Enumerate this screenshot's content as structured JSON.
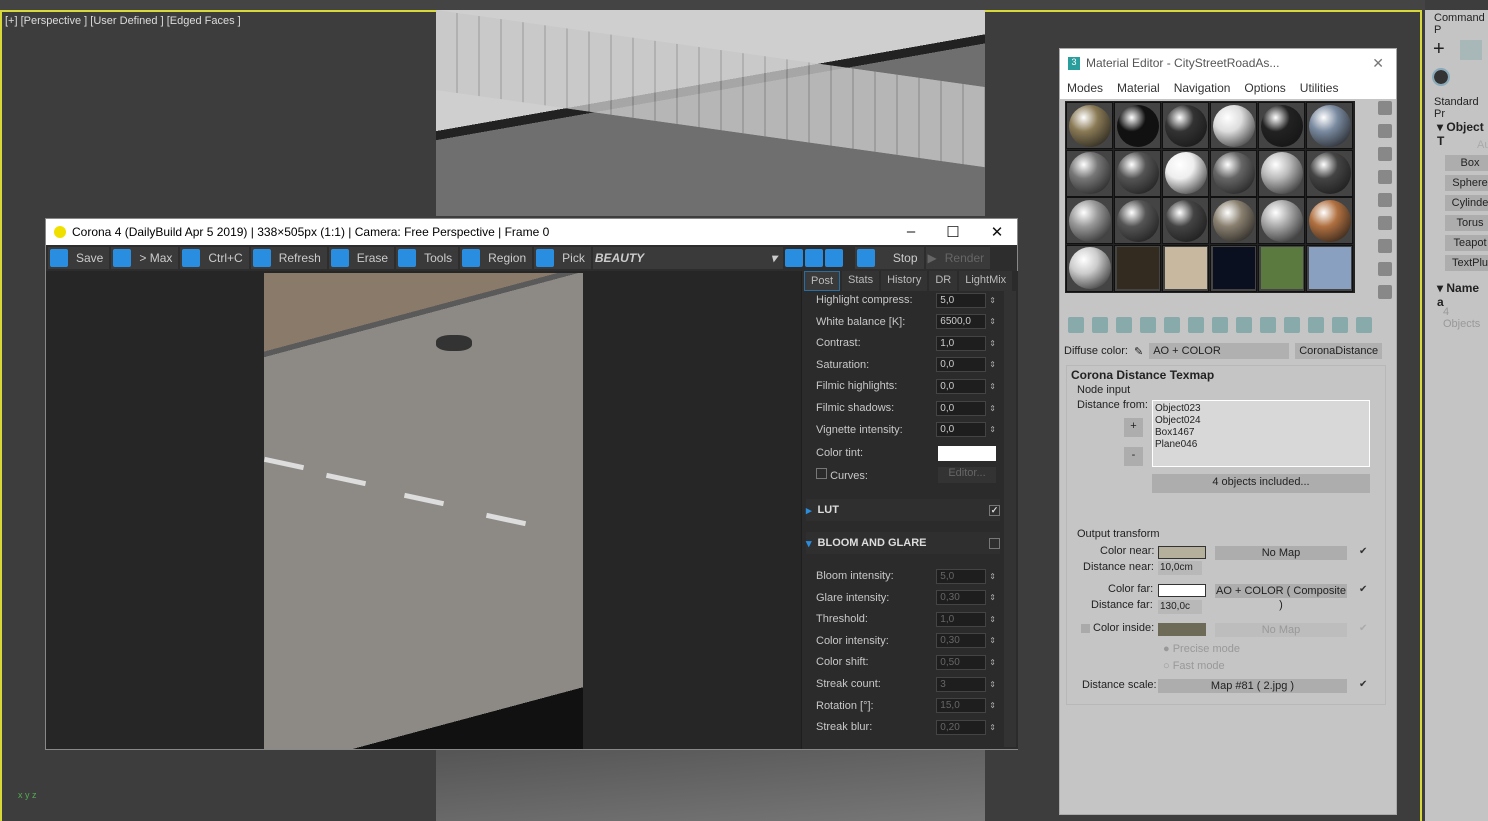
{
  "viewport": {
    "label": "[+] [Perspective ] [User Defined ] [Edged Faces ]",
    "axis": "x y z"
  },
  "vfb": {
    "title": "Corona 4 (DailyBuild Apr  5 2019) | 338×505px (1:1) | Camera: Free Perspective | Frame 0",
    "toolbar": [
      "Save",
      "> Max",
      "Ctrl+C",
      "Refresh",
      "Erase",
      "Tools",
      "Region",
      "Pick"
    ],
    "channel": "BEAUTY",
    "stop": "Stop",
    "render": "Render",
    "tabs": [
      "Post",
      "Stats",
      "History",
      "DR",
      "LightMix"
    ],
    "active_tab": "Post",
    "post": [
      {
        "label": "Highlight compress:",
        "value": "5,0"
      },
      {
        "label": "White balance [K]:",
        "value": "6500,0"
      },
      {
        "label": "Contrast:",
        "value": "1,0"
      },
      {
        "label": "Saturation:",
        "value": "0,0"
      },
      {
        "label": "Filmic highlights:",
        "value": "0,0"
      },
      {
        "label": "Filmic shadows:",
        "value": "0,0"
      },
      {
        "label": "Vignette intensity:",
        "value": "0,0"
      }
    ],
    "color_tint": "Color tint:",
    "color_tint_value": "#ffffff",
    "curves": "Curves:",
    "editor": "Editor...",
    "lut": "LUT",
    "lut_checked": true,
    "bloom": "BLOOM AND GLARE",
    "bloom_checked": false,
    "bloom_rows": [
      {
        "label": "Bloom intensity:",
        "value": "5,0"
      },
      {
        "label": "Glare intensity:",
        "value": "0,30"
      },
      {
        "label": "Threshold:",
        "value": "1,0"
      },
      {
        "label": "Color intensity:",
        "value": "0,30"
      },
      {
        "label": "Color shift:",
        "value": "0,50"
      },
      {
        "label": "Streak count:",
        "value": "3"
      },
      {
        "label": "Rotation [°]:",
        "value": "15,0"
      },
      {
        "label": "Streak blur:",
        "value": "0,20"
      }
    ]
  },
  "material_editor": {
    "title": "Material Editor - CityStreetRoadAs...",
    "menu": [
      "Modes",
      "Material",
      "Navigation",
      "Options",
      "Utilities"
    ],
    "diffuse_label": "Diffuse color:",
    "diffuse_value": "AO + COLOR",
    "map_name": "CoronaDistance",
    "rollout_title": "Corona Distance Texmap",
    "node_input": "Node input",
    "distance_from": "Distance from:",
    "objects": [
      "Object023",
      "Object024",
      "Box1467",
      "Plane046"
    ],
    "plus": "+",
    "minus": "-",
    "included": "4 objects included...",
    "output_transform": "Output transform",
    "color_near": "Color near:",
    "color_near_value": "#b5b09c",
    "near_map": "No Map",
    "distance_near": "Distance near:",
    "distance_near_value": "10,0cm",
    "color_far": "Color far:",
    "color_far_value": "#ffffff",
    "far_map": "AO + COLOR  ( Composite )",
    "distance_far": "Distance far:",
    "distance_far_value": "130,0c",
    "color_inside": "Color inside:",
    "color_inside_value": "#6e6a58",
    "inside_map": "No Map",
    "precise": "Precise mode",
    "fast": "Fast mode",
    "distance_scale": "Distance scale:",
    "scale_map": "Map #81 ( 2.jpg )"
  },
  "command_panel": {
    "title": "Command P",
    "dropdown": "Standard Pr",
    "section": "Object T",
    "auto": "Au",
    "buttons": [
      "Box",
      "Sphere",
      "Cylinde",
      "Torus",
      "Teapot",
      "TextPlu"
    ],
    "name_section": "Name a",
    "name_value": "4 Objects"
  }
}
